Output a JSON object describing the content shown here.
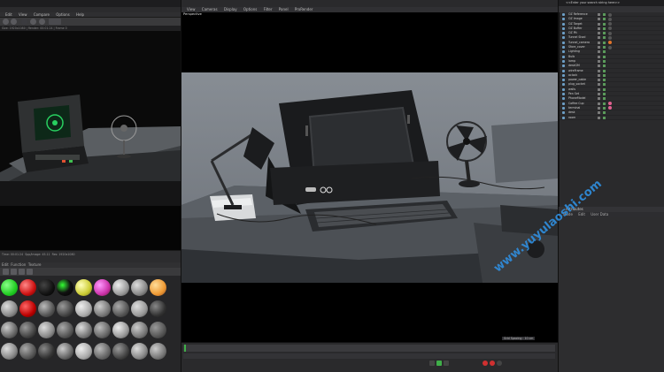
{
  "left_panel": {
    "menu": [
      "Edit",
      "View",
      "Compare",
      "Options",
      "Help"
    ],
    "info_text": "Size: 1920x1080 | Render: 00:01:24 | Frame 0",
    "status": [
      "Time: 00:01:24",
      "Spp/Image: 45.11",
      "Res: 1920x1080"
    ],
    "material_header": [
      "Edit",
      "Function",
      "Texture"
    ]
  },
  "viewport": {
    "menu": [
      "View",
      "Cameras",
      "Display",
      "Options",
      "Filter",
      "Panel",
      "ProRender"
    ],
    "camera_label": "Perspective",
    "grid_spacing": "Grid Spacing : 10 cm"
  },
  "object_manager": {
    "search_placeholder": "<<Enter your search string here>>",
    "objects": [
      "OZ Reference",
      "OZ Image",
      "OZ Target",
      "OZ Buffer",
      "OZ Pit",
      "Tunnel Shad",
      "Tunnel_camera",
      "Sfore_cover",
      "Lighting",
      "Bulb",
      "lamp",
      "deskGM",
      "wireFrame",
      "aclock",
      "power_cable",
      "plug_socket",
      "walls",
      "Pen Set",
      "PhoneModel",
      "Coffee Cup",
      "terminal",
      "desk",
      "room"
    ]
  },
  "attributes": {
    "title": "Attributes",
    "tabs": [
      "Mode",
      "Edit",
      "User Data"
    ]
  },
  "watermark": "www.yuyulaoshi.com",
  "colors": {
    "accent_green": "#3fae48",
    "watermark_blue": "#2f8fe0",
    "selection_orange": "#e2742a"
  }
}
